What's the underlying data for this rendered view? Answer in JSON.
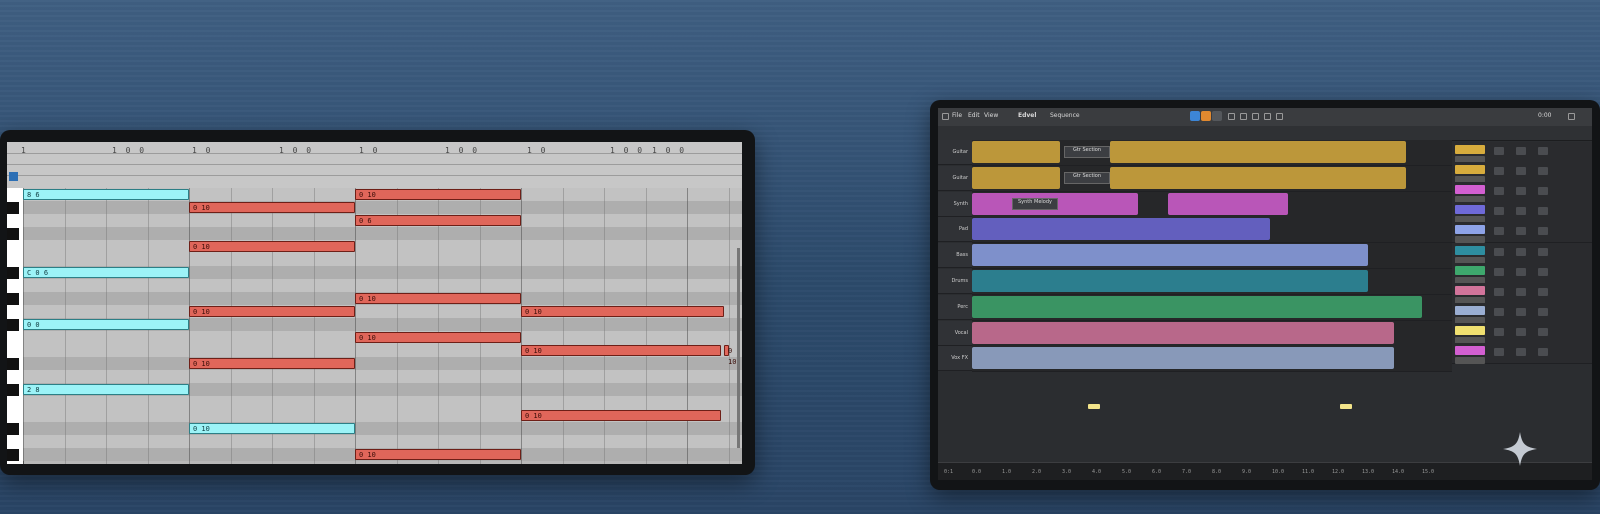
{
  "piano_roll": {
    "ruler_labels": [
      "1",
      "1 0 0",
      "1 0",
      "1 0 0",
      "1 0",
      "1 0 0",
      "1 0",
      "1 0 0",
      "1 0 0"
    ],
    "notes": [
      {
        "label": "8 6",
        "color": "cyan"
      },
      {
        "label": "0 10",
        "color": "red"
      },
      {
        "label": "0 10",
        "color": "red"
      },
      {
        "label": "0 6",
        "color": "red"
      },
      {
        "label": "0 10",
        "color": "red"
      },
      {
        "label": "C 0 6",
        "color": "cyan"
      },
      {
        "label": "0 10",
        "color": "red"
      },
      {
        "label": "0 10",
        "color": "red"
      },
      {
        "label": "0 10",
        "color": "red"
      },
      {
        "label": "0 0",
        "color": "cyan"
      },
      {
        "label": "0 10",
        "color": "red"
      },
      {
        "label": "0 10",
        "color": "red"
      },
      {
        "label": "0 10",
        "color": "red"
      },
      {
        "label": "0 10",
        "color": "red"
      },
      {
        "label": "2 8",
        "color": "cyan"
      },
      {
        "label": "0 10",
        "color": "red"
      },
      {
        "label": "0 10",
        "color": "cyan"
      },
      {
        "label": "0 10",
        "color": "red"
      }
    ]
  },
  "daw": {
    "toolbar": {
      "items": [
        "File",
        "Edit",
        "View",
        "Edvel",
        "Sequence"
      ],
      "time": "0:00"
    },
    "tracks": [
      {
        "name": "Guitar",
        "clip_color": "#d7ac3d",
        "clip_label": "Gtr Section"
      },
      {
        "name": "Guitar",
        "clip_color": "#d7ac3d",
        "clip_label": "Gtr Section"
      },
      {
        "name": "Synth",
        "clip_color": "#d35fd1",
        "clip_label": "Synth Melody"
      },
      {
        "name": "Pad",
        "clip_color": "#6f6ad8",
        "clip_label": ""
      },
      {
        "name": "Bass",
        "clip_color": "#8ea3e8",
        "clip_label": ""
      },
      {
        "name": "Drums",
        "clip_color": "#2e8ea0",
        "clip_label": ""
      },
      {
        "name": "Perc",
        "clip_color": "#3ea86d",
        "clip_label": ""
      },
      {
        "name": "Vocal",
        "clip_color": "#d2749b",
        "clip_label": ""
      },
      {
        "name": "Vox FX",
        "clip_color": "#9aaed2",
        "clip_label": ""
      }
    ],
    "mixer_colors": [
      "#d7ac3d",
      "#d7ac3d",
      "#d35fd1",
      "#6f6ad8",
      "#8ea3e8",
      "#2e8ea0",
      "#3ea86d",
      "#d2749b",
      "#9aaed2",
      "#f0e070",
      "#d35fd1"
    ],
    "status": {
      "left": "0:1",
      "marks": [
        "0.0",
        "1.0",
        "2.0",
        "3.0",
        "4.0",
        "5.0",
        "6.0",
        "7.0",
        "8.0",
        "9.0",
        "10.0",
        "11.0",
        "12.0",
        "13.0",
        "14.0",
        "15.0"
      ]
    }
  }
}
